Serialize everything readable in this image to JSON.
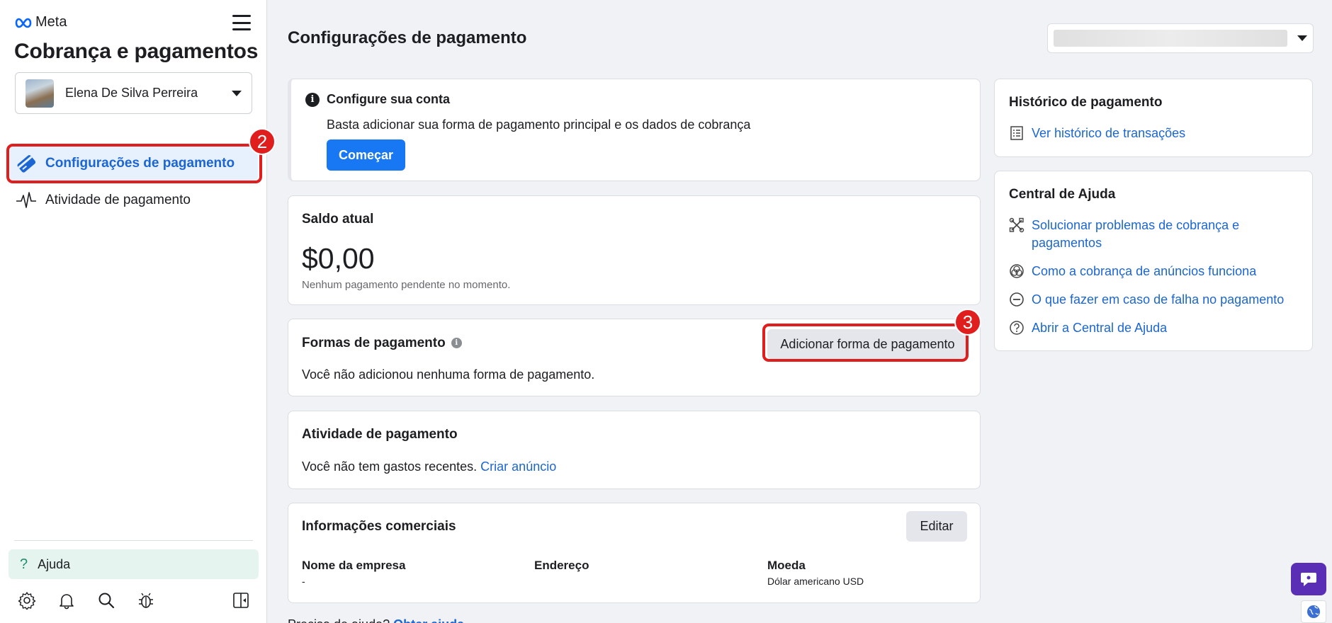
{
  "sidebar": {
    "brand": "Meta",
    "app_title": "Cobrança e pagamentos",
    "account_name": "Elena De Silva Perreira",
    "nav": [
      {
        "label": "Configurações de pagamento",
        "icon": "credit-card-icon",
        "active": true
      },
      {
        "label": "Atividade de pagamento",
        "icon": "activity-pulse-icon",
        "active": false
      }
    ],
    "help_label": "Ajuda",
    "toolbar_icons": [
      "gear-icon",
      "bell-icon",
      "search-icon",
      "bug-icon",
      "panel-toggle-icon"
    ]
  },
  "annotations": {
    "badge_nav": "2",
    "badge_add": "3",
    "color": "#e01e1e"
  },
  "main": {
    "page_title": "Configurações de pagamento",
    "setup": {
      "title": "Configure sua conta",
      "description": "Basta adicionar sua forma de pagamento principal e os dados de cobrança",
      "button": "Começar"
    },
    "balance": {
      "title": "Saldo atual",
      "amount": "$0,00",
      "subtitle": "Nenhum pagamento pendente no momento."
    },
    "payment_methods": {
      "title": "Formas de pagamento",
      "add_button": "Adicionar forma de pagamento",
      "empty_text": "Você não adicionou nenhuma forma de pagamento."
    },
    "activity": {
      "title": "Atividade de pagamento",
      "text": "Você não tem gastos recentes.",
      "link": "Criar anúncio"
    },
    "business": {
      "title": "Informações comerciais",
      "edit_button": "Editar",
      "fields": [
        {
          "label": "Nome da empresa",
          "value": "-"
        },
        {
          "label": "Endereço",
          "value": ""
        },
        {
          "label": "Moeda",
          "value": "Dólar americano USD"
        }
      ]
    },
    "below_text": "Precisa de ajuda?",
    "below_link": "Obter ajuda"
  },
  "right": {
    "history": {
      "title": "Histórico de pagamento",
      "link": "Ver histórico de transações"
    },
    "help_center": {
      "title": "Central de Ajuda",
      "links": [
        {
          "label": "Solucionar problemas de cobrança e pagamentos",
          "icon": "wrench-icon"
        },
        {
          "label": "Como a cobrança de anúncios funciona",
          "icon": "circles-icon"
        },
        {
          "label": "O que fazer em caso de falha no pagamento",
          "icon": "minus-circle-icon"
        },
        {
          "label": "Abrir a Central de Ajuda",
          "icon": "question-circle-icon"
        }
      ]
    }
  },
  "colors": {
    "accent": "#1877f2",
    "link": "#1b66d2",
    "active_bg": "#e7f0fd",
    "help_bg": "#e6f4ef",
    "chat": "#5b2fb5"
  }
}
